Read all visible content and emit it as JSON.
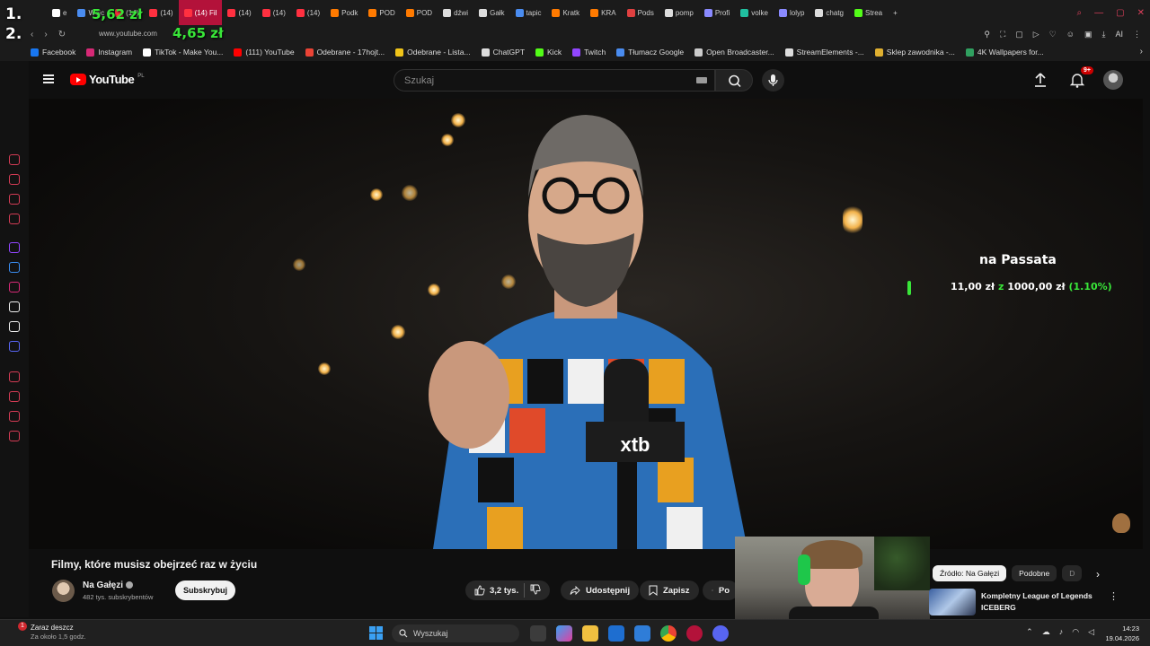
{
  "browser": {
    "tabs": [
      {
        "label": "e",
        "color": "#ffffff"
      },
      {
        "label": "Wojc",
        "color": "#4a8cf0"
      },
      {
        "label": "(14)",
        "color": "#ff3040"
      },
      {
        "label": "(14)",
        "color": "#ff3040"
      },
      {
        "label": "(14) Fil",
        "color": "#ff3040",
        "active": true
      },
      {
        "label": "(14)",
        "color": "#ff3040"
      },
      {
        "label": "(14)",
        "color": "#ff3040"
      },
      {
        "label": "(14)",
        "color": "#ff3040"
      },
      {
        "label": "Podk",
        "color": "#ff7a00"
      },
      {
        "label": "POD",
        "color": "#ff7a00"
      },
      {
        "label": "POD",
        "color": "#ff7a00"
      },
      {
        "label": "dźwi",
        "color": "#dddddd"
      },
      {
        "label": "Gałk",
        "color": "#dddddd"
      },
      {
        "label": "tapic",
        "color": "#4a8cf0"
      },
      {
        "label": "Kratk",
        "color": "#ff7a00"
      },
      {
        "label": "KRA",
        "color": "#ff7a00"
      },
      {
        "label": "Pods",
        "color": "#e04040"
      },
      {
        "label": "pomp",
        "color": "#dddddd"
      },
      {
        "label": "Profi",
        "color": "#8a8aff"
      },
      {
        "label": "volke",
        "color": "#20c0a0"
      },
      {
        "label": "lolyp",
        "color": "#8a8aff"
      },
      {
        "label": "chatg",
        "color": "#dddddd"
      },
      {
        "label": "Strea",
        "color": "#53fc18"
      }
    ],
    "url": "www.youtube.com",
    "bookmarks": [
      {
        "label": "Facebook",
        "color": "#1877f2"
      },
      {
        "label": "Instagram",
        "color": "#d62976"
      },
      {
        "label": "TikTok - Make You...",
        "color": "#ffffff"
      },
      {
        "label": "(111) YouTube",
        "color": "#ff0000"
      },
      {
        "label": "Odebrane - 17hojt...",
        "color": "#ea4335"
      },
      {
        "label": "Odebrane - Lista...",
        "color": "#f0c419"
      },
      {
        "label": "ChatGPT",
        "color": "#dddddd"
      },
      {
        "label": "Kick",
        "color": "#53fc18"
      },
      {
        "label": "Twitch",
        "color": "#9146ff"
      },
      {
        "label": "Tłumacz Google",
        "color": "#4a8cf0"
      },
      {
        "label": "Open Broadcaster...",
        "color": "#cccccc"
      },
      {
        "label": "StreamElements -...",
        "color": "#dddddd"
      },
      {
        "label": "Sklep zawodnika -...",
        "color": "#e0b030"
      },
      {
        "label": "4K Wallpapers for...",
        "color": "#30a060"
      }
    ]
  },
  "overlay": {
    "rank1": "1.",
    "rank2": "2.",
    "amount1": "5,62 zł",
    "amount2": "4,65 zł"
  },
  "youtube": {
    "logo_text": "YouTube",
    "region": "PL",
    "search_placeholder": "Szukaj",
    "notifications": "9+"
  },
  "video": {
    "goal_title": "na Passata",
    "goal_current": "11,00 zł",
    "goal_sep": "z",
    "goal_target": "1000,00 zł",
    "goal_percent": "(1.10%)",
    "goal_progress_pct": 1.1,
    "mic_brand": "xtb",
    "title": "Filmy, które musisz obejrzeć raz w życiu"
  },
  "channel": {
    "name": "Na Gałęzi",
    "subs": "482 tys. subskrybentów",
    "subscribe": "Subskrybuj"
  },
  "actions": {
    "likes": "3,2 tys.",
    "share": "Udostępnij",
    "save": "Zapisz",
    "more": "Po"
  },
  "sidepanel": {
    "chips": [
      "Źródło: Na Gałęzi",
      "Podobne",
      "D"
    ],
    "rec_title": "Kompletny League of Legends ICEBERG"
  },
  "taskbar": {
    "weather_badge": "1",
    "weather_title": "Zaraz deszcz",
    "weather_sub": "Za około 1,5 godz.",
    "search": "Wyszukaj",
    "time": "14:23",
    "date": "19.04.2026"
  },
  "colors": {
    "accent_red": "#ff0000",
    "money_green": "#39e639",
    "active_tab": "#b3123a"
  }
}
